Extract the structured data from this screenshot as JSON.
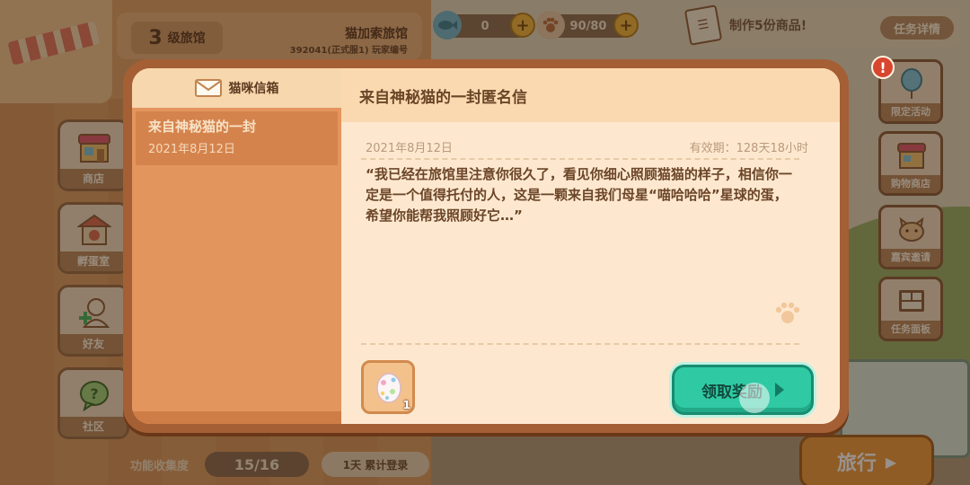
{
  "hud": {
    "level_number": "3",
    "level_label": "级旅馆",
    "inn_name": "猫加索旅馆",
    "server_line": "392041(正式服1) 玩家编号",
    "gem_count": "0",
    "stamina": "90/80",
    "task_text": "制作5份商品!",
    "task_detail_label": "任务详情"
  },
  "left_menu": [
    {
      "label": "商店"
    },
    {
      "label": "孵蛋室"
    },
    {
      "label": "好友"
    },
    {
      "label": "社区"
    }
  ],
  "right_menu": [
    {
      "label": "限定活动"
    },
    {
      "label": "购物商店"
    },
    {
      "label": "嘉宾邀请"
    },
    {
      "label": "任务面板"
    }
  ],
  "alert_badge": "!",
  "bottom": {
    "collect_label": "功能收集度",
    "collect_value": "15/16",
    "login_text": "1天 累计登录",
    "travel_label": "旅行"
  },
  "mailbox": {
    "title": "猫咪信箱",
    "items": [
      {
        "title": "来自神秘猫的一封",
        "date": "2021年8月12日"
      }
    ],
    "letter": {
      "title": "来自神秘猫的一封匿名信",
      "date": "2021年8月12日",
      "expiry": "有效期：128天18小时",
      "body": "“我已经在旅馆里注意你很久了，看见你细心照顾猫猫的样子，相信你一定是一个值得托付的人，这是一颗来自我们母星“喵哈哈哈”星球的蛋，希望你能帮我照顾好它…”",
      "reward_count": "1",
      "claim_label": "领取奖励"
    }
  },
  "colors": {
    "accent_green": "#2fc9a4",
    "modal_frame": "#a45f35",
    "letter_bg": "#fde8cf"
  }
}
